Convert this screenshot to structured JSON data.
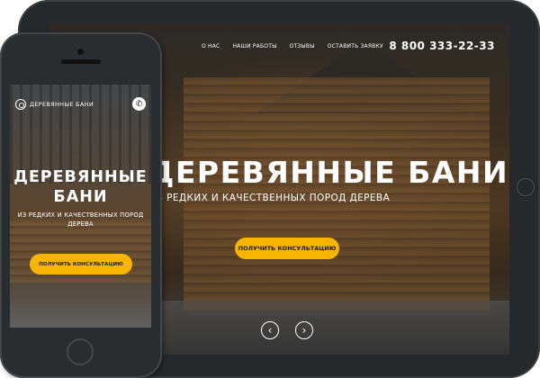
{
  "tablet": {
    "nav": [
      "О НАС",
      "НАШИ РАБОТЫ",
      "ОТЗЫВЫ",
      "ОСТАВИТЬ ЗАЯВКУ"
    ],
    "phone": "8 800 333-22-33",
    "title": "ДЕРЕВЯННЫЕ БАНИ",
    "subtitle": "ИЗ РЕДКИХ И КАЧЕСТВЕННЫХ ПОРОД ДЕРЕВА",
    "cta_label": "ПОЛУЧИТЬ КОНСУЛЬТАЦИЮ",
    "prev_icon": "‹",
    "next_icon": "›"
  },
  "phone": {
    "logo_text": "ДЕРЕВЯННЫЕ БАНИ",
    "call_icon": "✆",
    "title": "ДЕРЕВЯННЫЕ БАНИ",
    "subtitle": "ИЗ РЕДКИХ И КАЧЕСТВЕННЫХ ПОРОД ДЕРЕВА",
    "cta_label": "ПОЛУЧИТЬ КОНСУЛЬТАЦИЮ"
  },
  "colors": {
    "accent": "#f7b500",
    "device_body": "#26292b",
    "text": "#ffffff"
  }
}
